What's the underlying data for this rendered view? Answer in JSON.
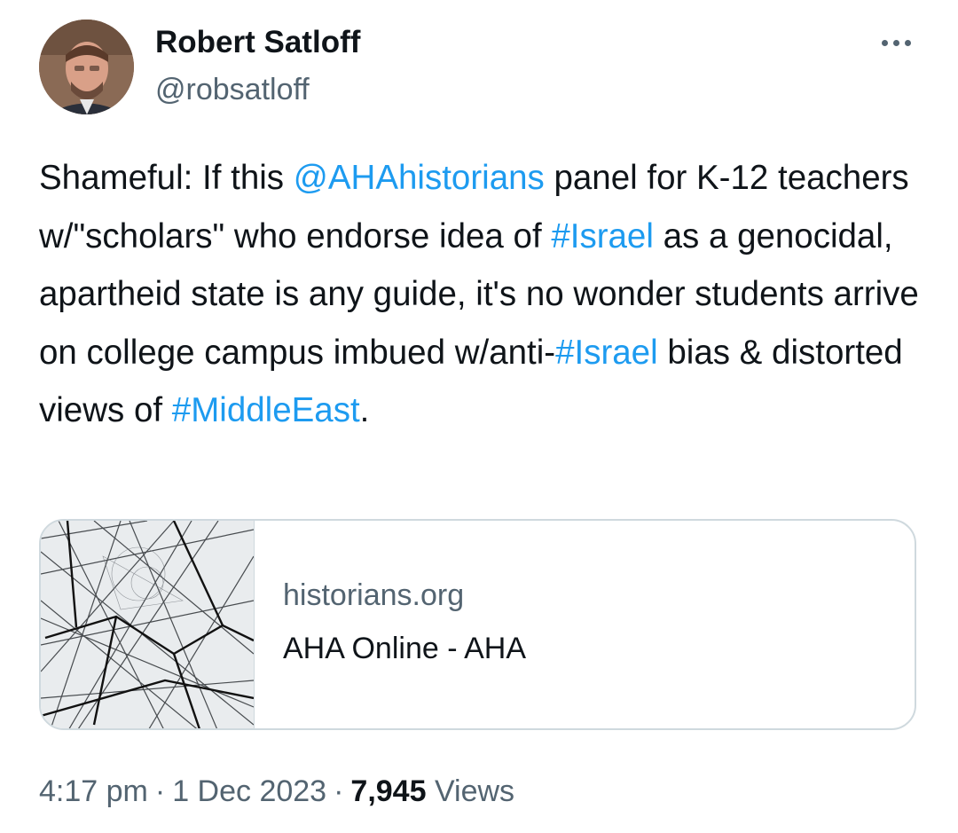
{
  "author": {
    "display_name": "Robert Satloff",
    "handle": "@robsatloff",
    "avatar_icon": "profile-photo"
  },
  "more_icon": "more-dots-icon",
  "tweet": {
    "segments": [
      {
        "text": "Shameful: If this ",
        "type": "text"
      },
      {
        "text": "@AHAhistorians",
        "type": "mention"
      },
      {
        "text": " panel for K-12 teachers w/\"scholars\" who endorse idea of ",
        "type": "text"
      },
      {
        "text": "#Israel",
        "type": "hashtag"
      },
      {
        "text": " as a genocidal, apartheid state is any guide, it's no wonder students arrive on college campus imbued w/anti-",
        "type": "text"
      },
      {
        "text": "#Israel",
        "type": "hashtag"
      },
      {
        "text": " bias & distorted views of ",
        "type": "text"
      },
      {
        "text": "#MiddleEast",
        "type": "hashtag"
      },
      {
        "text": ".",
        "type": "text"
      }
    ]
  },
  "link_card": {
    "domain": "historians.org",
    "title": "AHA Online - AHA",
    "image_icon": "network-lines-image"
  },
  "meta": {
    "time": "4:17 pm",
    "separator": "·",
    "date": "1 Dec 2023",
    "views_count": "7,945",
    "views_label": "Views"
  },
  "colors": {
    "link": "#1d9bf0",
    "text": "#0f1419",
    "secondary": "#536471",
    "border": "#cfd9de"
  }
}
